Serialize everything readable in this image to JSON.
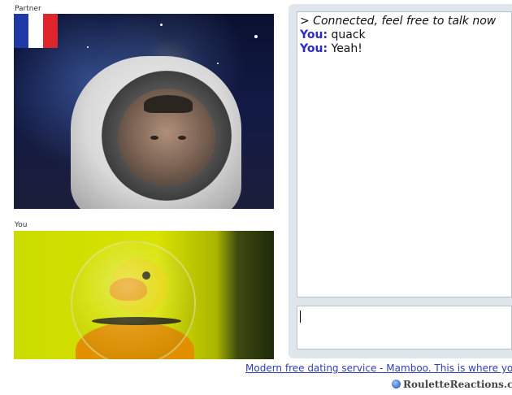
{
  "partner": {
    "label": "Partner"
  },
  "self": {
    "label": "You"
  },
  "chat": {
    "system_message": "> Connected, feel free to talk now",
    "messages": [
      {
        "sender": "You:",
        "text": "quack"
      },
      {
        "sender": "You:",
        "text": "Yeah!"
      }
    ],
    "input_value": ""
  },
  "ad": {
    "text": "Modern free dating service - Mamboo. This is where your"
  },
  "watermark": {
    "text": "RouletteReactions.com"
  },
  "colors": {
    "sender": "#2b2bc8",
    "link": "#2f3fb3",
    "panel": "#dfe6ec"
  }
}
